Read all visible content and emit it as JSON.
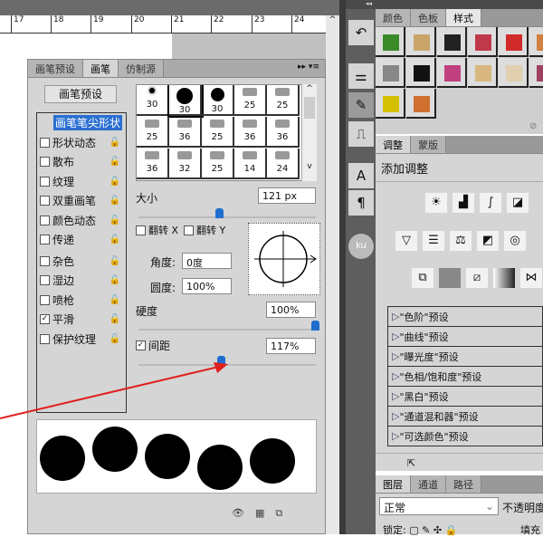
{
  "ruler": {
    "labels": [
      "17",
      "18",
      "19",
      "20",
      "21",
      "22",
      "23",
      "24"
    ]
  },
  "dock": {
    "collapse": "◂◂"
  },
  "brush_panel": {
    "tabs": [
      "画笔预设",
      "画笔",
      "仿制源"
    ],
    "active_tab": 1,
    "preset_button": "画笔预设",
    "options": [
      {
        "label": "画笔笔尖形状",
        "checked": null,
        "selected": true
      },
      {
        "label": "形状动态",
        "checked": false
      },
      {
        "label": "散布",
        "checked": false
      },
      {
        "label": "纹理",
        "checked": false
      },
      {
        "label": "双重画笔",
        "checked": false
      },
      {
        "label": "颜色动态",
        "checked": false
      },
      {
        "label": "传递",
        "checked": false
      },
      {
        "label": "杂色",
        "checked": false
      },
      {
        "label": "湿边",
        "checked": false
      },
      {
        "label": "喷枪",
        "checked": false
      },
      {
        "label": "平滑",
        "checked": true
      },
      {
        "label": "保护纹理",
        "checked": false
      }
    ],
    "tip_sizes": [
      "30",
      "30",
      "30",
      "25",
      "25",
      "25",
      "36",
      "25",
      "36",
      "36",
      "36",
      "32",
      "25",
      "14",
      "24"
    ],
    "size_label": "大小",
    "size_value": "121 px",
    "size_slider": 0.46,
    "flip_x": "翻转 X",
    "flip_y": "翻转 Y",
    "angle_label": "角度:",
    "angle_value": "0度",
    "roundness_label": "圆度:",
    "roundness_value": "100%",
    "hardness_label": "硬度",
    "hardness_value": "100%",
    "hardness_slider": 1.0,
    "spacing_label": "间距",
    "spacing_value": "117%",
    "spacing_checked": true,
    "spacing_slider": 0.47
  },
  "styles_panel": {
    "tabs": [
      "颜色",
      "色板",
      "样式"
    ],
    "active_tab": 2,
    "swatches": [
      "#3a8a2a",
      "#c9a56a",
      "#222",
      "#c0394a",
      "#d02a2a",
      "#d08040",
      "#888",
      "#111",
      "#c04080",
      "#d8b880",
      "#e0d0b0",
      "#a04060",
      "#d4c000",
      "#d07030"
    ]
  },
  "adjust_panel": {
    "tabs": [
      "调整",
      "蒙版"
    ],
    "active_tab": 0,
    "title": "添加调整",
    "presets": [
      "\"色阶\"预设",
      "\"曲线\"预设",
      "\"曝光度\"预设",
      "\"色相/饱和度\"预设",
      "\"黑白\"预设",
      "\"通道混和器\"预设",
      "\"可选颜色\"预设"
    ]
  },
  "layers_panel": {
    "tabs": [
      "图层",
      "通道",
      "路径"
    ],
    "active_tab": 0,
    "blend_mode": "正常",
    "opacity_label": "不透明度",
    "lock_label": "锁定:",
    "fill_label": "填充"
  },
  "colors": {
    "accent": "#1e6ecf",
    "arrow": "#e02020"
  }
}
